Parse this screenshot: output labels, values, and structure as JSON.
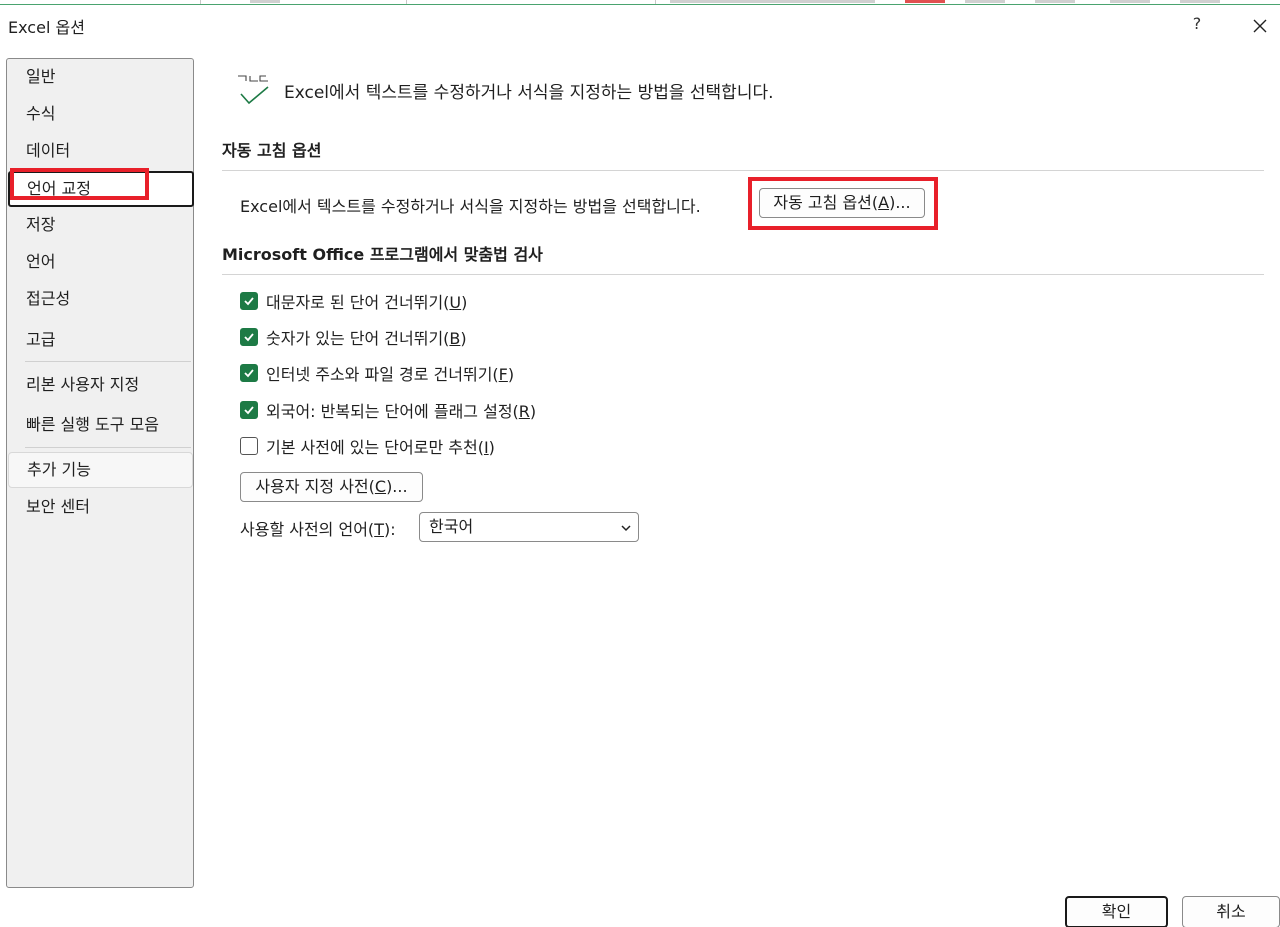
{
  "window": {
    "title": "Excel 옵션",
    "help_label": "?"
  },
  "sidebar": {
    "items": [
      {
        "label": "일반"
      },
      {
        "label": "수식"
      },
      {
        "label": "데이터"
      },
      {
        "label": "언어 교정",
        "selected": true
      },
      {
        "label": "저장"
      },
      {
        "label": "언어"
      },
      {
        "label": "접근성"
      },
      {
        "label": "고급"
      },
      {
        "label": "리본 사용자 지정"
      },
      {
        "label": "빠른 실행 도구 모음"
      },
      {
        "label": "추가 기능"
      },
      {
        "label": "보안 센터"
      }
    ]
  },
  "header": {
    "icon": "abc-check-icon",
    "text": "Excel에서 텍스트를 수정하거나 서식을 지정하는 방법을 선택합니다."
  },
  "autocorrect": {
    "section_title": "자동 고침 옵션",
    "description": "Excel에서 텍스트를 수정하거나 서식을 지정하는 방법을 선택합니다.",
    "button_label": "자동 고침 옵션(",
    "button_accel": "A",
    "button_suffix": ")..."
  },
  "spelling": {
    "section_title": "Microsoft Office 프로그램에서 맞춤법 검사",
    "options": [
      {
        "label": "대문자로 된 단어 건너뛰기(",
        "accel": "U",
        "suffix": ")",
        "checked": true
      },
      {
        "label": "숫자가 있는 단어 건너뛰기(",
        "accel": "B",
        "suffix": ")",
        "checked": true
      },
      {
        "label": "인터넷 주소와 파일 경로 건너뛰기(",
        "accel": "F",
        "suffix": ")",
        "checked": true
      },
      {
        "label": "외국어: 반복되는 단어에 플래그 설정(",
        "accel": "R",
        "suffix": ")",
        "checked": true
      },
      {
        "label": "기본 사전에 있는 단어로만 추천(",
        "accel": "I",
        "suffix": ")",
        "checked": false
      }
    ],
    "custom_dict_label": "사용자 지정 사전(",
    "custom_dict_accel": "C",
    "custom_dict_suffix": ")...",
    "dict_lang_label": "사용할 사전의 언어(",
    "dict_lang_accel": "T",
    "dict_lang_suffix": "):",
    "dict_lang_value": "한국어"
  },
  "footer": {
    "ok_label": "확인",
    "cancel_label": "취소"
  },
  "colors": {
    "check_green": "#1d7a45",
    "highlight_red": "#e8202a"
  }
}
